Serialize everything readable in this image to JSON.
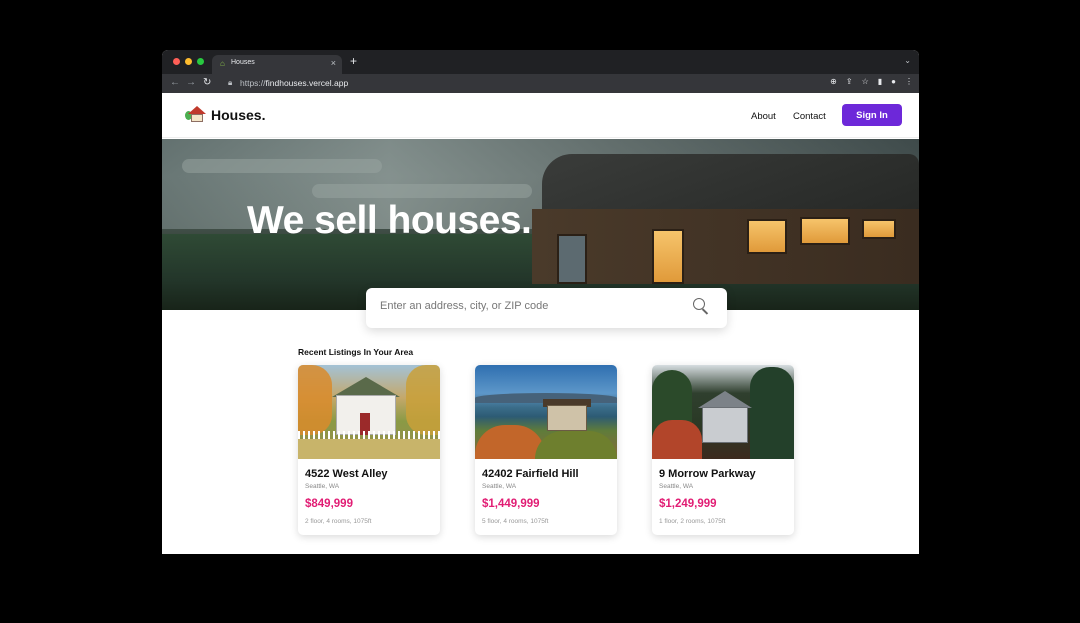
{
  "browser": {
    "tab_title": "Houses",
    "tab_close": "×",
    "new_tab": "+",
    "tab_menu": "⌄",
    "url_prefix": "https://",
    "url_host": "findhouses.vercel.app"
  },
  "header": {
    "logo_text": "Houses.",
    "nav": [
      "About",
      "Contact"
    ],
    "signin_label": "Sign In",
    "accent": "#6d28d9"
  },
  "hero": {
    "title": "We sell houses."
  },
  "search": {
    "placeholder": "Enter an address, city, or ZIP code"
  },
  "listings": {
    "section_title": "Recent Listings In Your Area",
    "price_color": "#e11d74",
    "items": [
      {
        "name": "4522 West Alley",
        "location": "Seattle, WA",
        "price": "$849,999",
        "meta": "2 floor, 4 rooms, 1075ft"
      },
      {
        "name": "42402 Fairfield Hill",
        "location": "Seattle, WA",
        "price": "$1,449,999",
        "meta": "5 floor, 4 rooms, 1075ft"
      },
      {
        "name": "9 Morrow Parkway",
        "location": "Seattle, WA",
        "price": "$1,249,999",
        "meta": "1 floor, 2 rooms, 1075ft"
      }
    ]
  }
}
